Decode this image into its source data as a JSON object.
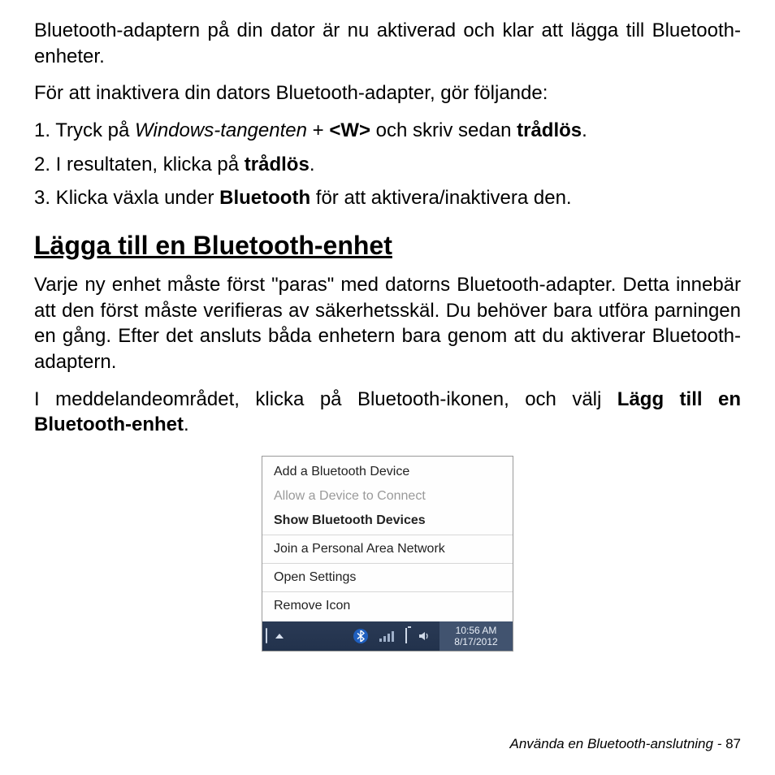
{
  "intro": "Bluetooth-adaptern på din dator är nu aktiverad och klar att lägga till Bluetooth-enheter.",
  "disable_intro": "För att inaktivera din dators Bluetooth-adapter, gör följande:",
  "steps": {
    "s1_a": "1. Tryck på ",
    "s1_winkey": "Windows-tangenten",
    "s1_plus": " + ",
    "s1_w": "<W>",
    "s1_mid": " och skriv sedan ",
    "s1_tradlos": "trådlös",
    "s1_end": ".",
    "s2_a": "2. I resultaten, klicka på ",
    "s2_tradlos": "trådlös",
    "s2_end": ".",
    "s3_a": "3. Klicka växla under ",
    "s3_bt": "Bluetooth",
    "s3_end": " för att aktivera/inaktivera den."
  },
  "heading": "Lägga till en Bluetooth-enhet",
  "pair_para": "Varje ny enhet måste först \"paras\" med datorns Bluetooth-adapter. Detta innebär att den först måste verifieras av säkerhetsskäl. Du behöver bara utföra parningen en gång. Efter det ansluts båda enhetern bara genom att du aktiverar Bluetooth-adaptern.",
  "notif_a": "I meddelandeområdet, klicka på Bluetooth-ikonen, och välj ",
  "notif_bold": "Lägg till en Bluetooth-enhet",
  "notif_end": ".",
  "menu": {
    "add": "Add a Bluetooth Device",
    "allow": "Allow a Device to Connect",
    "show": "Show Bluetooth Devices",
    "join": "Join a Personal Area Network",
    "open": "Open Settings",
    "remove": "Remove Icon"
  },
  "taskbar": {
    "bt_glyph": "✱",
    "speaker_glyph": "🔈",
    "time": "10:56 AM",
    "date": "8/17/2012"
  },
  "footer": {
    "text": "Använda en Bluetooth-anslutning -  ",
    "page": "87"
  }
}
